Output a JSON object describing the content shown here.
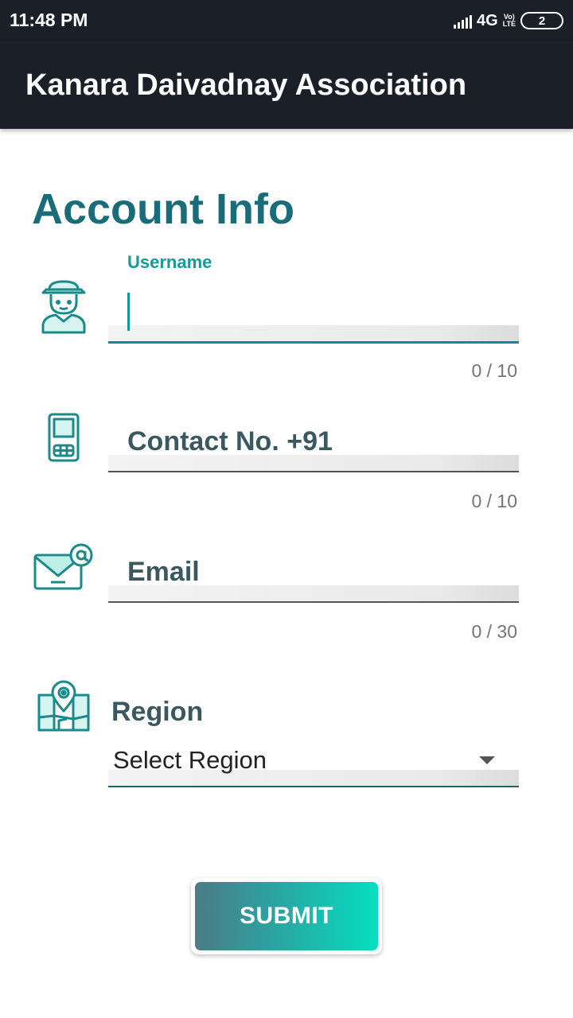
{
  "status_bar": {
    "time": "11:48 PM",
    "network": "4G",
    "volte_top": "Vo)",
    "volte_bottom": "LTE",
    "battery": "2"
  },
  "app_bar": {
    "title": "Kanara Daivadnay Association",
    "background": "#1b1f27"
  },
  "form": {
    "heading": "Account Info",
    "accent_color": "#1a6d78",
    "fields": {
      "username": {
        "label": "Username",
        "value": "",
        "counter": "0 / 10",
        "icon": "user-icon",
        "focused": true
      },
      "contact": {
        "label": "Contact No. +91",
        "value": "",
        "counter": "0 / 10",
        "icon": "mobile-phone-icon"
      },
      "email": {
        "label": "Email",
        "value": "",
        "counter": "0 / 30",
        "icon": "email-icon"
      },
      "region": {
        "label": "Region",
        "selected": "Select Region",
        "icon": "map-pin-icon"
      }
    },
    "submit_label": "SUBMIT"
  }
}
